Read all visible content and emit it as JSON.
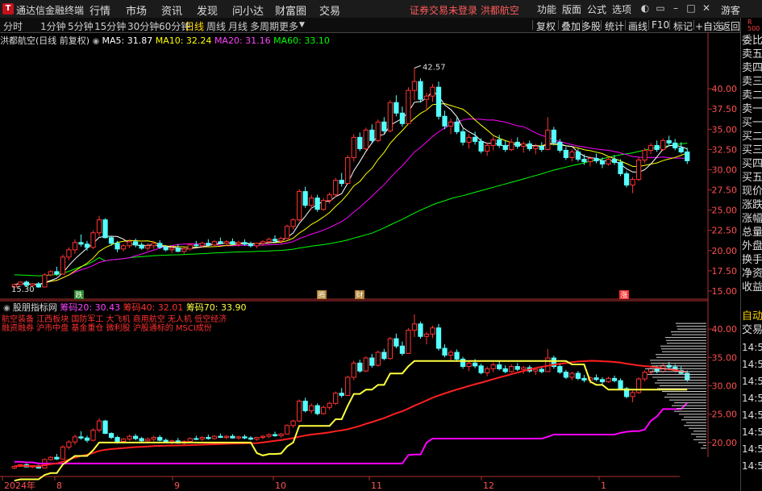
{
  "app": {
    "title": "通达信金融终端",
    "menu": [
      "行情",
      "市场",
      "资讯",
      "发现",
      "问小达",
      "财富圈",
      "交易"
    ],
    "warning": "证券交易未登录 洪都航空",
    "right_menu": [
      "功能",
      "版面",
      "公式",
      "选项"
    ],
    "user": "游客"
  },
  "tabs": {
    "periods": [
      "分时",
      "1分钟",
      "5分钟",
      "15分钟",
      "30分钟",
      "60分钟",
      "日线",
      "周线",
      "月线",
      "多周期",
      "更多"
    ],
    "active": "日线",
    "tools": [
      "复权",
      "叠加",
      "多股",
      "统计",
      "画线",
      "F10",
      "标记",
      "+自选",
      "返回"
    ]
  },
  "main_info": {
    "title": "洪都航空(日线 前复权)",
    "ma5": "MA5: 31.87",
    "ma10": "MA10: 32.24",
    "ma20": "MA20: 31.16",
    "ma60": "MA60: 33.10"
  },
  "sub_info": {
    "title": "股朋指标网",
    "c20": "筹码20: 30.43",
    "c40": "筹码40: 32.01",
    "c70": "筹码70: 33.90"
  },
  "concepts": {
    "line1": "航空装备 江西板块 国防军工 大飞机 商用航空 无人机 低空经济",
    "line2": "融资融券 沪市中盘 基金重仓 微利股 沪股通标的 MSCI成份"
  },
  "price_labels": {
    "high": "42.57",
    "low": "15.30"
  },
  "event_marks": [
    "跌",
    "腾",
    "财",
    "涨"
  ],
  "main_axis": [
    "40.00",
    "37.50",
    "35.00",
    "32.50",
    "30.00",
    "27.50",
    "25.00",
    "22.50",
    "20.00",
    "17.50",
    "15.00"
  ],
  "sub_axis": [
    "40.00",
    "35.00",
    "30.00",
    "25.00",
    "20.00"
  ],
  "date_axis": [
    "2024年",
    "8",
    "9",
    "10",
    "11",
    "12",
    "1"
  ],
  "right_panel": {
    "labels": [
      "委比",
      "卖五",
      "卖四",
      "卖三",
      "卖二",
      "卖一",
      "买一",
      "买二",
      "买三",
      "买四",
      "买五",
      "现价",
      "涨跌",
      "涨幅",
      "总量",
      "外盘",
      "换手",
      "净资",
      "收益"
    ],
    "badge": "R\n500",
    "auto": "自动",
    "trade": "交易",
    "times": [
      "14:5",
      "14:5",
      "14:5",
      "14:5",
      "14:5",
      "14:5",
      "14:5",
      "14:5"
    ]
  },
  "colors": {
    "up": "#ff3232",
    "down": "#54ffff",
    "ma5": "#ffffff",
    "ma10": "#ffff00",
    "ma20": "#ff00ff",
    "ma60": "#00ff00",
    "chip20": "#ff00ff",
    "chip40": "#ff2020",
    "chip70": "#ffff40"
  },
  "chart_data": {
    "type": "candlestick",
    "title": "洪都航空(日线 前复权)",
    "ylim": [
      14.5,
      45
    ],
    "series": [
      {
        "name": "MA5",
        "values": [
          31.87
        ]
      },
      {
        "name": "MA10",
        "values": [
          32.24
        ]
      },
      {
        "name": "MA20",
        "values": [
          31.16
        ]
      },
      {
        "name": "MA60",
        "values": [
          33.1
        ]
      }
    ],
    "ohlc": [
      [
        15.5,
        15.9,
        15.3,
        15.8
      ],
      [
        15.8,
        16.2,
        15.7,
        16.1
      ],
      [
        16.1,
        16.3,
        15.6,
        15.7
      ],
      [
        15.7,
        16.0,
        15.5,
        15.9
      ],
      [
        15.9,
        16.1,
        15.4,
        15.5
      ],
      [
        15.5,
        17.2,
        15.5,
        17.0
      ],
      [
        17.0,
        17.6,
        16.8,
        17.4
      ],
      [
        17.4,
        18.0,
        16.9,
        17.1
      ],
      [
        17.1,
        19.5,
        17.0,
        19.2
      ],
      [
        19.2,
        20.4,
        18.8,
        20.1
      ],
      [
        20.1,
        21.4,
        19.6,
        21.0
      ],
      [
        21.0,
        22.0,
        20.5,
        20.8
      ],
      [
        20.8,
        21.2,
        20.0,
        20.4
      ],
      [
        20.4,
        22.5,
        20.2,
        22.2
      ],
      [
        22.2,
        24.3,
        21.8,
        23.8
      ],
      [
        23.8,
        24.0,
        21.5,
        21.6
      ],
      [
        21.6,
        21.8,
        20.6,
        20.9
      ],
      [
        20.9,
        21.2,
        19.8,
        20.2
      ],
      [
        20.2,
        20.8,
        19.9,
        20.6
      ],
      [
        20.6,
        21.4,
        20.3,
        21.1
      ],
      [
        21.1,
        21.5,
        20.4,
        20.7
      ],
      [
        20.7,
        21.0,
        20.1,
        20.3
      ],
      [
        20.3,
        20.9,
        20.0,
        20.6
      ],
      [
        20.6,
        21.2,
        20.2,
        20.9
      ],
      [
        20.9,
        21.3,
        20.2,
        20.4
      ],
      [
        20.4,
        20.7,
        19.9,
        20.1
      ],
      [
        20.1,
        20.5,
        19.7,
        20.3
      ],
      [
        20.3,
        20.8,
        19.8,
        19.9
      ],
      [
        19.9,
        20.4,
        19.6,
        20.2
      ],
      [
        20.2,
        20.9,
        20.0,
        20.7
      ],
      [
        20.7,
        21.2,
        20.4,
        20.6
      ],
      [
        20.6,
        21.1,
        20.3,
        20.9
      ],
      [
        20.9,
        21.4,
        20.5,
        20.7
      ],
      [
        20.7,
        21.3,
        20.5,
        21.1
      ],
      [
        21.1,
        21.6,
        20.8,
        20.9
      ],
      [
        20.9,
        21.3,
        20.6,
        21.1
      ],
      [
        21.1,
        21.5,
        20.7,
        20.8
      ],
      [
        20.8,
        21.2,
        20.5,
        21.0
      ],
      [
        21.0,
        21.4,
        20.6,
        20.8
      ],
      [
        20.8,
        21.1,
        20.4,
        20.6
      ],
      [
        20.6,
        21.0,
        20.3,
        20.9
      ],
      [
        20.9,
        21.3,
        20.6,
        21.1
      ],
      [
        21.1,
        21.6,
        20.8,
        21.4
      ],
      [
        21.4,
        21.9,
        21.0,
        21.2
      ],
      [
        21.2,
        21.7,
        20.9,
        21.5
      ],
      [
        21.5,
        23.2,
        21.4,
        23.0
      ],
      [
        23.0,
        24.0,
        22.6,
        23.8
      ],
      [
        23.8,
        27.6,
        23.6,
        27.3
      ],
      [
        27.3,
        27.9,
        25.3,
        25.6
      ],
      [
        25.6,
        26.9,
        25.1,
        26.5
      ],
      [
        26.5,
        26.9,
        24.8,
        25.1
      ],
      [
        25.1,
        26.5,
        24.9,
        26.2
      ],
      [
        26.2,
        27.2,
        25.8,
        26.9
      ],
      [
        26.9,
        29.0,
        26.6,
        28.7
      ],
      [
        28.7,
        29.6,
        27.9,
        28.3
      ],
      [
        28.3,
        31.8,
        28.2,
        31.5
      ],
      [
        31.5,
        34.4,
        31.0,
        34.0
      ],
      [
        34.0,
        34.6,
        32.3,
        32.6
      ],
      [
        32.6,
        35.2,
        32.4,
        34.9
      ],
      [
        34.9,
        35.6,
        33.2,
        33.6
      ],
      [
        33.6,
        36.2,
        33.4,
        35.9
      ],
      [
        35.9,
        36.5,
        34.5,
        34.8
      ],
      [
        34.8,
        38.6,
        34.6,
        38.3
      ],
      [
        38.3,
        39.2,
        36.6,
        37.0
      ],
      [
        37.0,
        37.8,
        35.3,
        35.7
      ],
      [
        35.7,
        40.2,
        35.6,
        39.8
      ],
      [
        39.8,
        42.57,
        38.6,
        40.9
      ],
      [
        40.9,
        41.3,
        38.3,
        38.7
      ],
      [
        38.7,
        39.5,
        37.3,
        39.1
      ],
      [
        39.1,
        40.6,
        38.4,
        40.2
      ],
      [
        40.2,
        40.9,
        36.2,
        36.6
      ],
      [
        36.6,
        37.3,
        35.0,
        35.4
      ],
      [
        35.4,
        36.3,
        34.4,
        35.9
      ],
      [
        35.9,
        36.4,
        34.4,
        34.7
      ],
      [
        34.7,
        35.1,
        33.0,
        33.4
      ],
      [
        33.4,
        34.4,
        32.6,
        34.0
      ],
      [
        34.0,
        34.7,
        33.1,
        33.5
      ],
      [
        33.5,
        33.9,
        32.0,
        32.3
      ],
      [
        32.3,
        33.4,
        31.7,
        33.0
      ],
      [
        33.0,
        34.1,
        32.4,
        33.7
      ],
      [
        33.7,
        34.3,
        32.7,
        33.0
      ],
      [
        33.0,
        33.6,
        32.2,
        32.5
      ],
      [
        32.5,
        33.8,
        32.3,
        33.4
      ],
      [
        33.4,
        34.0,
        32.6,
        32.9
      ],
      [
        32.9,
        33.5,
        32.1,
        33.2
      ],
      [
        33.2,
        33.6,
        32.3,
        32.6
      ],
      [
        32.6,
        33.2,
        31.9,
        32.9
      ],
      [
        32.9,
        33.4,
        32.2,
        32.5
      ],
      [
        32.5,
        36.5,
        32.4,
        34.9
      ],
      [
        34.9,
        35.3,
        33.0,
        33.4
      ],
      [
        33.4,
        33.8,
        32.1,
        32.4
      ],
      [
        32.4,
        32.8,
        31.2,
        31.5
      ],
      [
        31.5,
        32.5,
        31.0,
        32.2
      ],
      [
        32.2,
        32.6,
        31.0,
        31.3
      ],
      [
        31.3,
        31.9,
        30.6,
        31.0
      ],
      [
        31.0,
        31.7,
        30.4,
        31.4
      ],
      [
        31.4,
        32.0,
        30.8,
        31.1
      ],
      [
        31.1,
        31.5,
        30.2,
        30.7
      ],
      [
        30.7,
        31.6,
        30.5,
        31.3
      ],
      [
        31.3,
        31.8,
        30.6,
        30.9
      ],
      [
        30.9,
        31.3,
        29.2,
        29.5
      ],
      [
        29.5,
        29.8,
        27.8,
        28.1
      ],
      [
        28.1,
        29.1,
        27.1,
        28.8
      ],
      [
        28.8,
        31.5,
        28.6,
        31.2
      ],
      [
        31.2,
        32.7,
        30.8,
        32.4
      ],
      [
        32.4,
        33.3,
        31.9,
        33.0
      ],
      [
        33.0,
        33.6,
        32.2,
        32.5
      ],
      [
        32.5,
        33.9,
        32.3,
        33.6
      ],
      [
        33.6,
        34.2,
        32.9,
        33.3
      ],
      [
        33.3,
        33.8,
        32.4,
        32.7
      ],
      [
        32.7,
        33.4,
        32.0,
        32.2
      ],
      [
        32.2,
        32.7,
        30.7,
        31.1
      ]
    ],
    "volume_profile_note": "筹码分布"
  }
}
